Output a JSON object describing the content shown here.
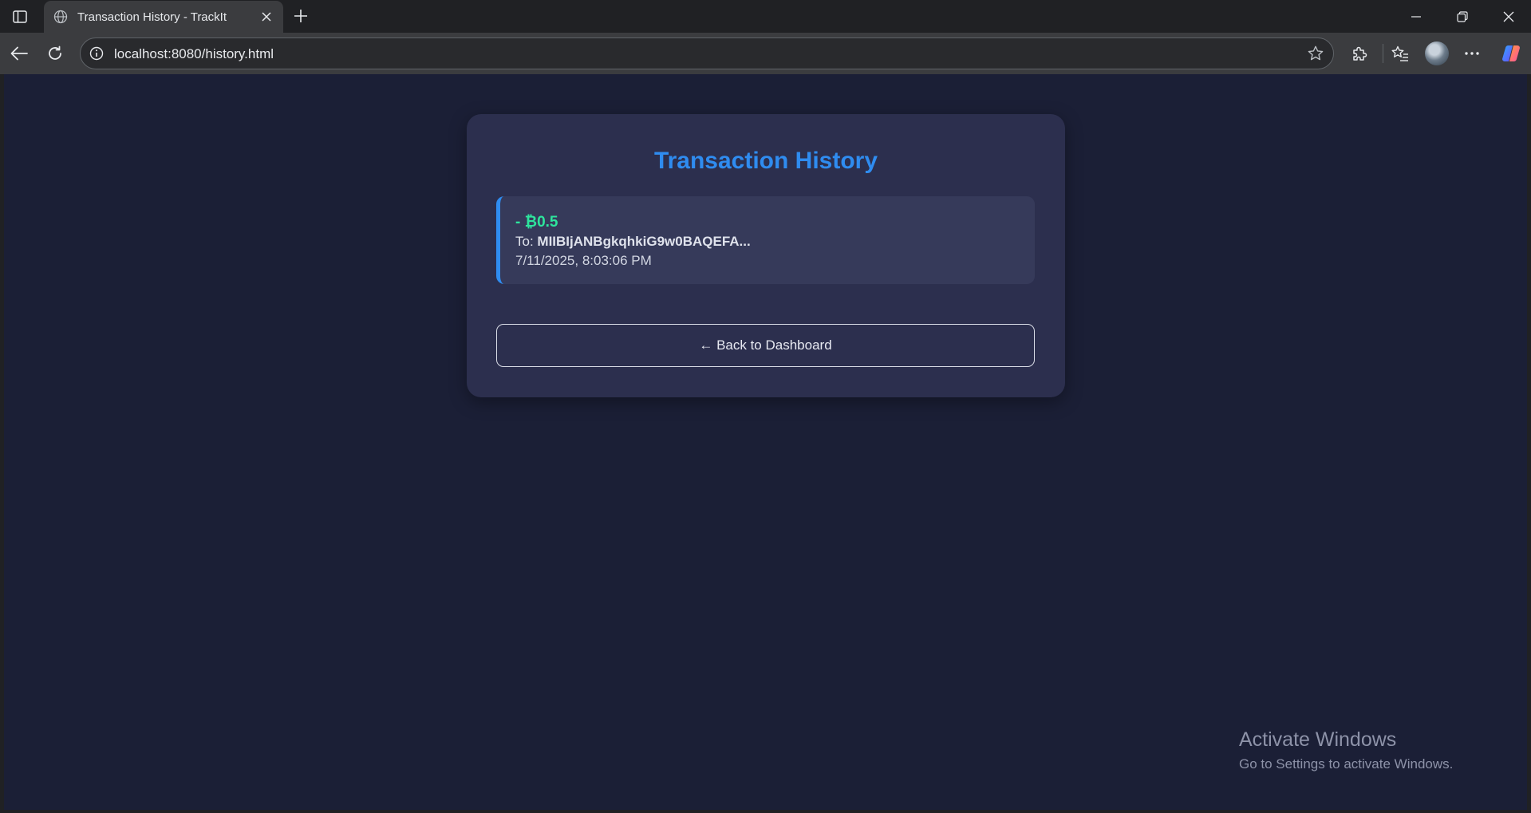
{
  "browser": {
    "tab_title": "Transaction History - TrackIt",
    "url": "localhost:8080/history.html",
    "icons": {
      "sidebar": "sidebar-toggle-icon",
      "favicon": "globe-icon",
      "tab_close": "close-icon",
      "new_tab": "plus-icon",
      "minimize": "minimize-icon",
      "restore": "restore-icon",
      "window_close": "close-icon",
      "back": "back-arrow-icon",
      "refresh": "refresh-icon",
      "site_info": "info-icon",
      "favorite": "star-icon",
      "extensions": "puzzle-icon",
      "favorites": "favorites-icon",
      "menu": "more-icon",
      "copilot": "copilot-icon"
    }
  },
  "page": {
    "title": "Transaction History",
    "transactions": [
      {
        "amount": "- ₿0.5",
        "to_label": "To: ",
        "to_address": "MIIBIjANBgkqhkiG9w0BAQEFA...",
        "datetime": "7/11/2025, 8:03:06 PM"
      }
    ],
    "back_button": "← Back to Dashboard"
  },
  "watermark": {
    "title": "Activate Windows",
    "subtitle": "Go to Settings to activate Windows."
  },
  "colors": {
    "accent": "#2f8cf0",
    "amount": "#2ee59d",
    "background": "#1b1f36",
    "card": "#2c2f4e"
  }
}
